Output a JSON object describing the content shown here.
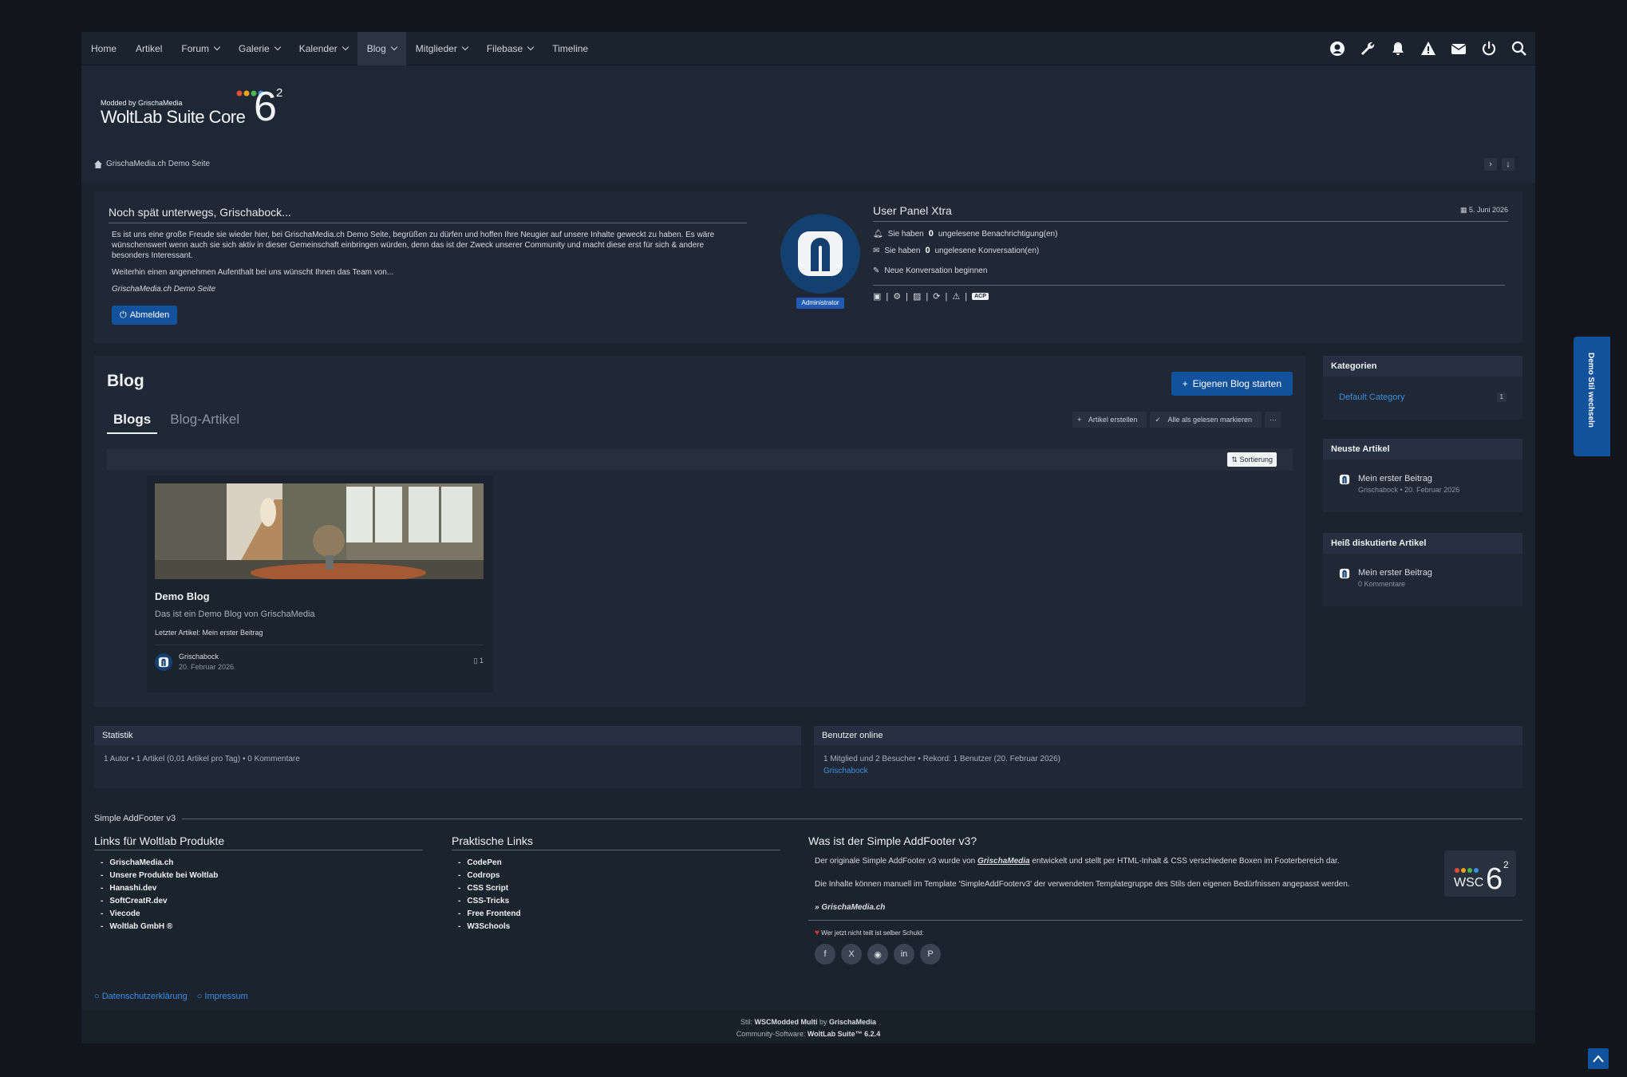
{
  "nav": {
    "items": [
      {
        "label": "Home",
        "dropdown": false
      },
      {
        "label": "Artikel",
        "dropdown": false
      },
      {
        "label": "Forum",
        "dropdown": true
      },
      {
        "label": "Galerie",
        "dropdown": true
      },
      {
        "label": "Kalender",
        "dropdown": true
      },
      {
        "label": "Blog",
        "dropdown": true,
        "active": true
      },
      {
        "label": "Mitglieder",
        "dropdown": true
      },
      {
        "label": "Filebase",
        "dropdown": true
      },
      {
        "label": "Timeline",
        "dropdown": false
      }
    ],
    "icons": [
      "user-icon",
      "wrench-icon",
      "bell-icon",
      "warning-icon",
      "envelope-icon",
      "power-icon",
      "search-icon"
    ]
  },
  "logo": {
    "small": "Modded by GrischaMedia",
    "main": "WoltLab Suite Core",
    "version": "6",
    "sup": "2"
  },
  "breadcrumb": {
    "home": "GrischaMedia.ch Demo Seite"
  },
  "welcome": {
    "title": "Noch spät unterwegs, Grischabock...",
    "p1": "Es ist uns eine große Freude sie wieder hier, bei GrischaMedia.ch Demo Seite, begrüßen zu dürfen und hoffen Ihre Neugier auf unsere Inhalte geweckt zu haben. Es wäre wünschenswert wenn auch sie sich aktiv in dieser Gemeinschaft einbringen würden, denn das ist der Zweck unserer Community und macht diese erst für sich & andere besonders Interessant.",
    "p2": "Weiterhin einen angenehmen Aufenthalt bei uns wünscht Ihnen das Team von...",
    "sign": "GrischaMedia.ch Demo Seite",
    "logout": "Abmelden",
    "badge": "Administrator"
  },
  "panel": {
    "title": "User Panel Xtra",
    "date": "5. Juni 2026",
    "notif_pre": "Sie haben",
    "notif_count": "0",
    "notif_post": "ungelesene Benachrichtigung(en)",
    "conv_pre": "Sie haben",
    "conv_count": "0",
    "conv_post": "ungelesene Konversation(en)",
    "new_conv": "Neue Konversation beginnen",
    "acp": "ACP"
  },
  "blog": {
    "title": "Blog",
    "start_button": "Eigenen Blog starten",
    "tabs": [
      "Blogs",
      "Blog-Artikel"
    ],
    "actions": {
      "create": "Artikel erstellen",
      "mark_read": "Alle als gelesen markieren",
      "more": "···"
    },
    "sort": "Sortierung",
    "card": {
      "title": "Demo Blog",
      "desc": "Das ist ein Demo Blog von GrischaMedia",
      "last": "Letzter Artikel: Mein erster Beitrag",
      "user": "Grischabock",
      "date": "20. Februar 2026",
      "count": "1"
    }
  },
  "sidebar": {
    "categories": {
      "title": "Kategorien",
      "item": "Default Category",
      "count": "1"
    },
    "latest": {
      "title": "Neuste Artikel",
      "item": "Mein erster Beitrag",
      "meta": "Grischabock • 20. Februar 2026"
    },
    "hot": {
      "title": "Heiß diskutierte Artikel",
      "item": "Mein erster Beitrag",
      "meta": "0 Kommentare"
    }
  },
  "stats": {
    "title": "Statistik",
    "text": "1 Autor  •  1 Artikel (0,01 Artikel pro Tag)  •  0 Kommentare"
  },
  "online": {
    "title": "Benutzer online",
    "text": "1 Mitglied und 2 Besucher  •  Rekord: 1 Benutzer (20. Februar 2026)",
    "user": "Grischabock"
  },
  "footer": {
    "label": "Simple AddFooter v3",
    "col1": {
      "title": "Links für Woltlab Produkte",
      "links": [
        "GrischaMedia.ch",
        "Unsere Produkte bei Woltlab",
        "Hanashi.dev",
        "SoftCreatR.dev",
        "Viecode",
        "Woltlab GmbH ®"
      ]
    },
    "col2": {
      "title": "Praktische Links",
      "links": [
        "CodePen",
        "Codrops",
        "CSS Script",
        "CSS-Tricks",
        "Free Frontend",
        "W3Schools"
      ]
    },
    "col3": {
      "title": "Was ist der Simple AddFooter v3?",
      "p1_pre": "Der originale Simple AddFooter v3 wurde von",
      "p1_author": "GrischaMedia",
      "p1_post": "entwickelt und stellt per HTML-Inhalt & CSS verschiedene Boxen im Footerbereich dar.",
      "p2": "Die Inhalte können manuell im Template 'SimpleAddFooterv3' der verwendeten Templategruppe des Stils den eigenen Bedürfnissen angepasst werden.",
      "link": "» GrischaMedia.ch",
      "share": "Wer jetzt nicht teilt ist selber Schuld:",
      "share_icons": [
        "facebook-icon",
        "x-icon",
        "reddit-icon",
        "linkedin-icon",
        "pinterest-icon"
      ]
    },
    "legal": [
      "Datenschutzerklärung",
      "Impressum"
    ],
    "style_pre": "Stil:",
    "style_name": "WSCModded Multi",
    "style_by": "by",
    "style_author": "GrischaMedia",
    "software_pre": "Community-Software:",
    "software": "WoltLab Suite™ 6.2.4"
  },
  "style_switch": "Demo Stil wechseln",
  "colors": {
    "accent": "#12529c",
    "link": "#3d8fe0",
    "bg": "#1b232e"
  }
}
